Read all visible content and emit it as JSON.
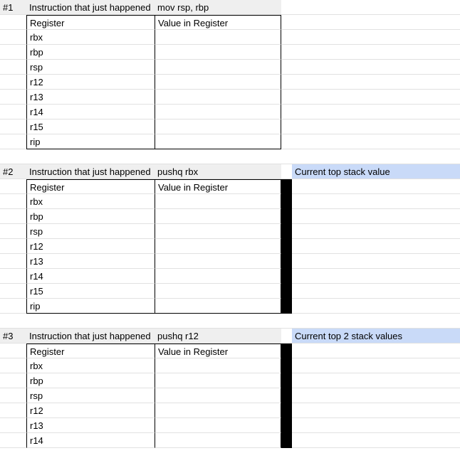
{
  "labels": {
    "instruction_header": "Instruction that just happened",
    "register_col": "Register",
    "value_col": "Value in Register"
  },
  "registers": [
    "rbx",
    "rbp",
    "rsp",
    "r12",
    "r13",
    "r14",
    "r15",
    "rip"
  ],
  "blocks": [
    {
      "id": "#1",
      "instruction": "mov rsp, rbp",
      "stack_label": "",
      "black_column": false
    },
    {
      "id": "#2",
      "instruction": "pushq rbx",
      "stack_label": "Current top stack value",
      "black_column": true
    },
    {
      "id": "#3",
      "instruction": "pushq r12",
      "stack_label": "Current top 2 stack values",
      "black_column": true,
      "truncate_registers": 6
    }
  ]
}
